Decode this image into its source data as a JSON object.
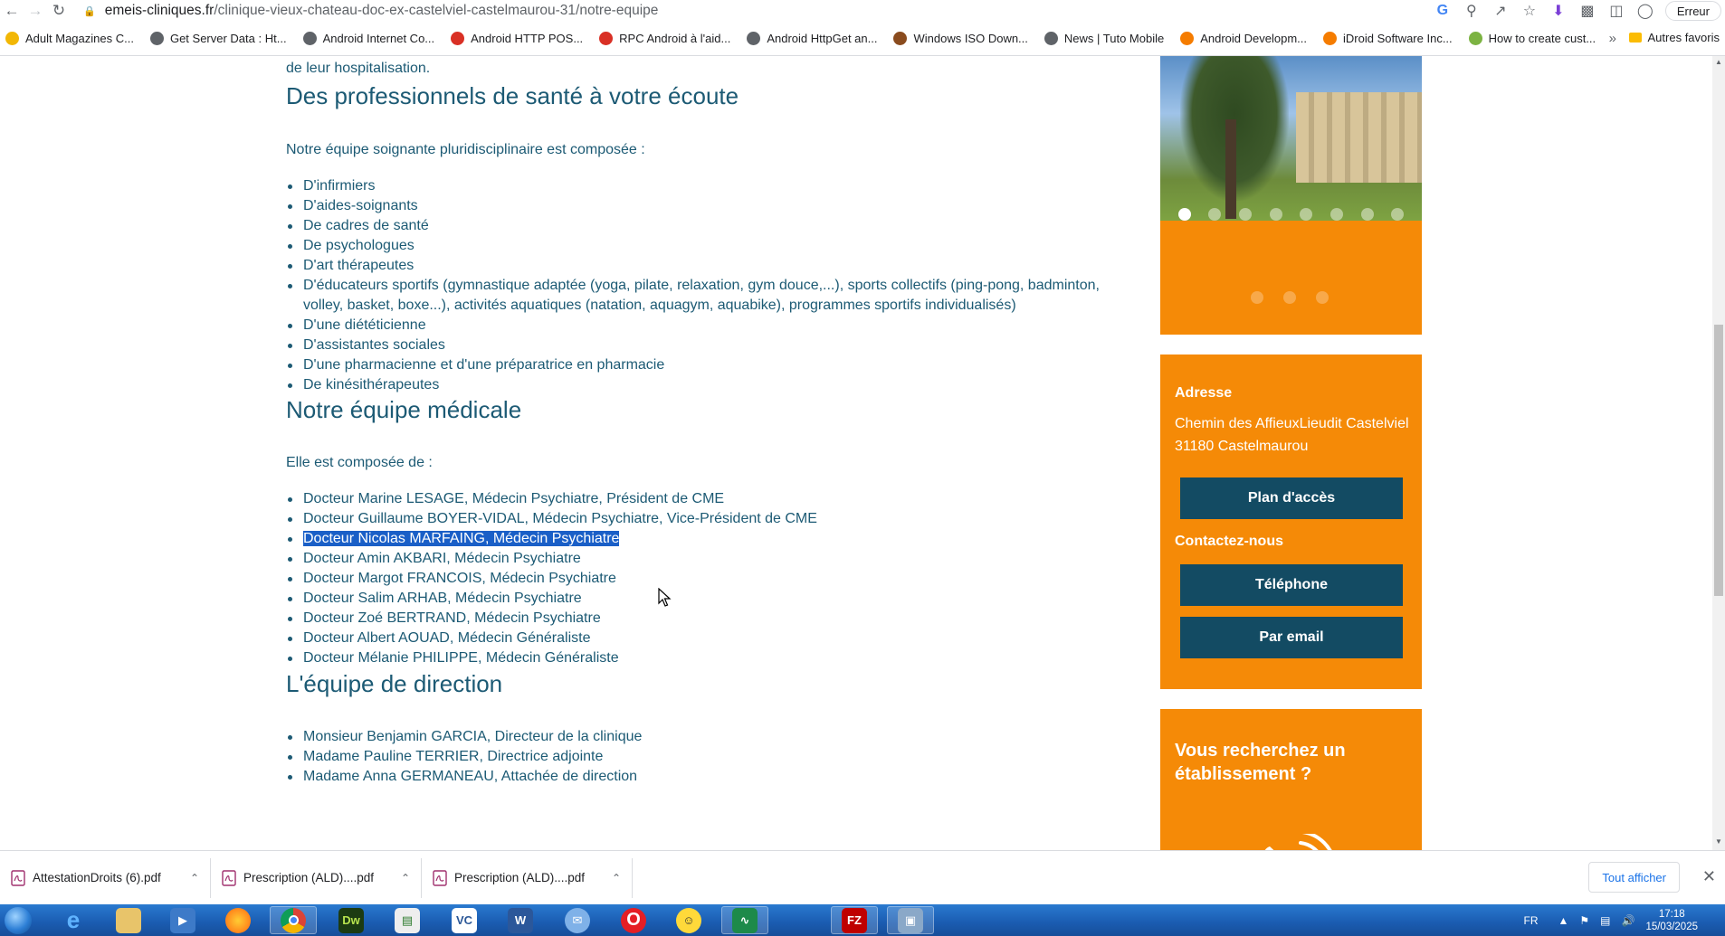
{
  "browser": {
    "url_domain": "emeis-cliniques.fr",
    "url_path": "/clinique-vieux-chateau-doc-ex-castelviel-castelmaurou-31/notre-equipe",
    "profile_label": "Erreur",
    "bookmarks": [
      {
        "label": "Adult Magazines C...",
        "color": "#f2b705"
      },
      {
        "label": "Get Server Data : Ht...",
        "color": "#5f6368"
      },
      {
        "label": "Android Internet Co...",
        "color": "#5f6368"
      },
      {
        "label": "Android HTTP POS...",
        "color": "#d93025"
      },
      {
        "label": "RPC Android à l'aid...",
        "color": "#d93025"
      },
      {
        "label": "Android HttpGet an...",
        "color": "#5f6368"
      },
      {
        "label": "Windows ISO Down...",
        "color": "#8a4b1e"
      },
      {
        "label": "News | Tuto Mobile",
        "color": "#5f6368"
      },
      {
        "label": "Android Developm...",
        "color": "#f57c00"
      },
      {
        "label": "iDroid Software Inc...",
        "color": "#f57c00"
      },
      {
        "label": "How to create cust...",
        "color": "#7cb342"
      }
    ],
    "bookmarks_other": "Autres favoris"
  },
  "page": {
    "fragment": "de leur hospitalisation.",
    "section1": {
      "title": "Des professionnels de santé à votre écoute",
      "intro": "Notre équipe soignante pluridisciplinaire est composée :",
      "items": [
        "D'infirmiers",
        "D'aides-soignants",
        "De cadres de santé",
        "De psychologues",
        "D'art thérapeutes",
        "D'éducateurs sportifs (gymnastique adaptée (yoga, pilate, relaxation, gym douce,...), sports collectifs (ping-pong, badminton, volley, basket, boxe...), activités aquatiques (natation, aquagym, aquabike), programmes sportifs individualisés)",
        "D'une diététicienne",
        "D'assistantes sociales",
        "D'une pharmacienne et d'une préparatrice en pharmacie",
        "De kinésithérapeutes"
      ]
    },
    "section2": {
      "title": "Notre équipe médicale",
      "intro": "Elle est composée de :",
      "items": [
        "Docteur Marine LESAGE, Médecin Psychiatre, Président de CME",
        "Docteur Guillaume BOYER-VIDAL, Médecin Psychiatre, Vice-Président de CME",
        "Docteur Nicolas MARFAING, Médecin Psychiatre",
        "Docteur Amin AKBARI, Médecin Psychiatre",
        "Docteur Margot FRANCOIS, Médecin Psychiatre",
        "Docteur Salim ARHAB, Médecin Psychiatre",
        "Docteur Zoé BERTRAND, Médecin Psychiatre",
        "Docteur Albert AOUAD, Médecin Généraliste",
        "Docteur Mélanie PHILIPPE, Médecin Généraliste"
      ]
    },
    "section3": {
      "title": "L'équipe de direction",
      "items": [
        "Monsieur Benjamin GARCIA, Directeur de la clinique",
        "Madame Pauline TERRIER, Directrice adjointe",
        "Madame Anna GERMANEAU, Attachée de direction"
      ]
    }
  },
  "sidebar": {
    "address_heading": "Adresse",
    "address_line1": "Chemin des AffieuxLieudit Castelviel",
    "address_line2": "31180 Castelmaurou",
    "plan_button": "Plan d'accès",
    "contact_heading": "Contactez-nous",
    "phone_button": "Téléphone",
    "email_button": "Par email",
    "search_title": "Vous recherchez un établissement ?",
    "accent_color": "#f58a07",
    "button_color": "#134b63"
  },
  "downloads": {
    "items": [
      "AttestationDroits (6).pdf",
      "Prescription (ALD)....pdf",
      "Prescription (ALD)....pdf"
    ],
    "show_all": "Tout afficher"
  },
  "taskbar": {
    "lang": "FR",
    "time": "17:18",
    "date": "15/03/2025"
  }
}
